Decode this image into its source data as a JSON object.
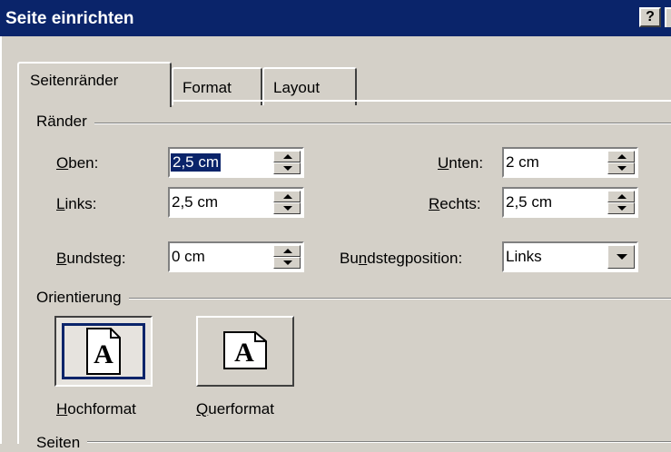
{
  "window": {
    "title": "Seite einrichten",
    "help_glyph": "?"
  },
  "tabs": [
    {
      "label": "Seitenränder",
      "active": true
    },
    {
      "label": "Format",
      "active": false
    },
    {
      "label": "Layout",
      "active": false
    }
  ],
  "margins": {
    "group_label": "Ränder",
    "top": {
      "label_key": "O",
      "label_rest": "ben:",
      "value": "2,5 cm"
    },
    "left": {
      "label_key": "L",
      "label_rest": "inks:",
      "value": "2,5 cm"
    },
    "gutter": {
      "label_key": "B",
      "label_rest": "undsteg:",
      "value": "0 cm"
    },
    "bottom": {
      "label_key": "U",
      "label_rest": "nten:",
      "value": "2 cm"
    },
    "right": {
      "label_key": "R",
      "label_rest": "echts:",
      "value": "2,5 cm"
    },
    "gutter_position": {
      "label_pre": "Bu",
      "label_key": "n",
      "label_rest": "dstegposition:",
      "value": "Links"
    }
  },
  "orientation": {
    "group_label": "Orientierung",
    "portrait": {
      "label_key": "H",
      "label_rest": "ochformat",
      "glyph": "A",
      "selected": true
    },
    "landscape": {
      "label_key": "Q",
      "label_rest": "uerformat",
      "glyph": "A",
      "selected": false
    }
  },
  "pages": {
    "group_label": "Seiten"
  },
  "colors": {
    "titlebar": "#0a246a",
    "face": "#d4d0c8",
    "selection": "#0a246a"
  },
  "icons": {
    "up": "spin-up-arrow-icon",
    "down": "spin-down-arrow-icon",
    "dropdown": "chevron-down-icon",
    "page": "page-icon"
  }
}
